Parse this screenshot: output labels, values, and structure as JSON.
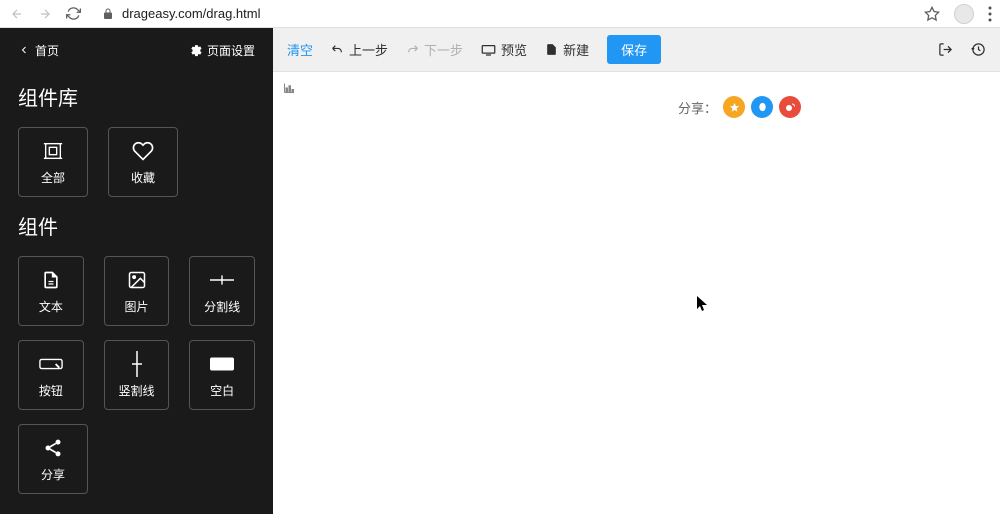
{
  "browser": {
    "url": "drageasy.com/drag.html"
  },
  "sidebar": {
    "home": "首页",
    "pageSettings": "页面设置",
    "library": {
      "title": "组件库",
      "tiles": [
        {
          "label": "全部",
          "icon": "select-all"
        },
        {
          "label": "收藏",
          "icon": "heart"
        }
      ]
    },
    "components": {
      "title": "组件",
      "tiles": [
        {
          "label": "文本",
          "icon": "file-text"
        },
        {
          "label": "图片",
          "icon": "image"
        },
        {
          "label": "分割线",
          "icon": "divider-h"
        },
        {
          "label": "按钮",
          "icon": "button"
        },
        {
          "label": "竖割线",
          "icon": "divider-v"
        },
        {
          "label": "空白",
          "icon": "blank"
        },
        {
          "label": "分享",
          "icon": "share"
        }
      ]
    }
  },
  "toolbar": {
    "clear": "清空",
    "undo": "上一步",
    "redo": "下一步",
    "preview": "预览",
    "new": "新建",
    "save": "保存"
  },
  "canvas": {
    "shareLabel": "分享："
  }
}
